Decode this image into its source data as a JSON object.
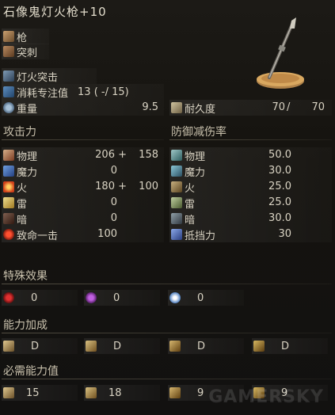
{
  "title": "石像鬼灯火枪+10",
  "weapon_type": "枪",
  "attack_type": "突刺",
  "skill": "灯火突击",
  "fp_cost_label": "消耗专注值",
  "fp_cost_value": "13 (   -/ 15)",
  "weight_label": "重量",
  "weight_value": "9.5",
  "durability_label": "耐久度",
  "durability_current": "70",
  "durability_max": "70",
  "attack": {
    "header": "攻击力",
    "rows": [
      {
        "label": "物理",
        "value": "206 +",
        "bonus": "158"
      },
      {
        "label": "魔力",
        "value": "0",
        "bonus": ""
      },
      {
        "label": "火",
        "value": "180 +",
        "bonus": "100"
      },
      {
        "label": "雷",
        "value": "0",
        "bonus": ""
      },
      {
        "label": "暗",
        "value": "0",
        "bonus": ""
      },
      {
        "label": "致命一击",
        "value": "100",
        "bonus": ""
      }
    ]
  },
  "defense": {
    "header": "防御减伤率",
    "rows": [
      {
        "label": "物理",
        "value": "50.0"
      },
      {
        "label": "魔力",
        "value": "30.0"
      },
      {
        "label": "火",
        "value": "25.0"
      },
      {
        "label": "雷",
        "value": "25.0"
      },
      {
        "label": "暗",
        "value": "30.0"
      },
      {
        "label": "抵挡力",
        "value": "30"
      }
    ]
  },
  "special": {
    "header": "特殊效果",
    "values": [
      "0",
      "0",
      "0"
    ]
  },
  "scaling": {
    "header": "能力加成",
    "values": [
      "D",
      "D",
      "D",
      "D"
    ]
  },
  "requirements": {
    "header": "必需能力值",
    "values": [
      "15",
      "18",
      "9",
      "9"
    ]
  },
  "watermark": "GAMERSKY"
}
